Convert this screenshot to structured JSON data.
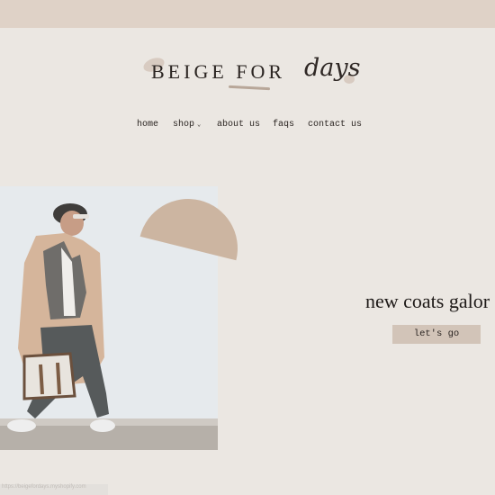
{
  "header": {
    "logo": {
      "main_text": "BEIGE FOR",
      "script_text": "days"
    }
  },
  "nav": {
    "items": [
      {
        "label": "home"
      },
      {
        "label": "shop"
      },
      {
        "label": "about us"
      },
      {
        "label": "faqs"
      },
      {
        "label": "contact us"
      }
    ],
    "shop_chevron": "⌄"
  },
  "hero": {
    "headline": "new coats galor",
    "cta_label": "let's go"
  },
  "status_bar": {
    "text": "https://beigefordays.myshopify.com"
  },
  "colors": {
    "page_background": "#ebe7e2",
    "announcement_bar": "#dfd2c7",
    "accent_shape": "#ccb5a1",
    "button_background": "#d2c4b8",
    "text": "#2b2522"
  },
  "icons": {
    "shop_dropdown": "chevron-down-icon"
  }
}
